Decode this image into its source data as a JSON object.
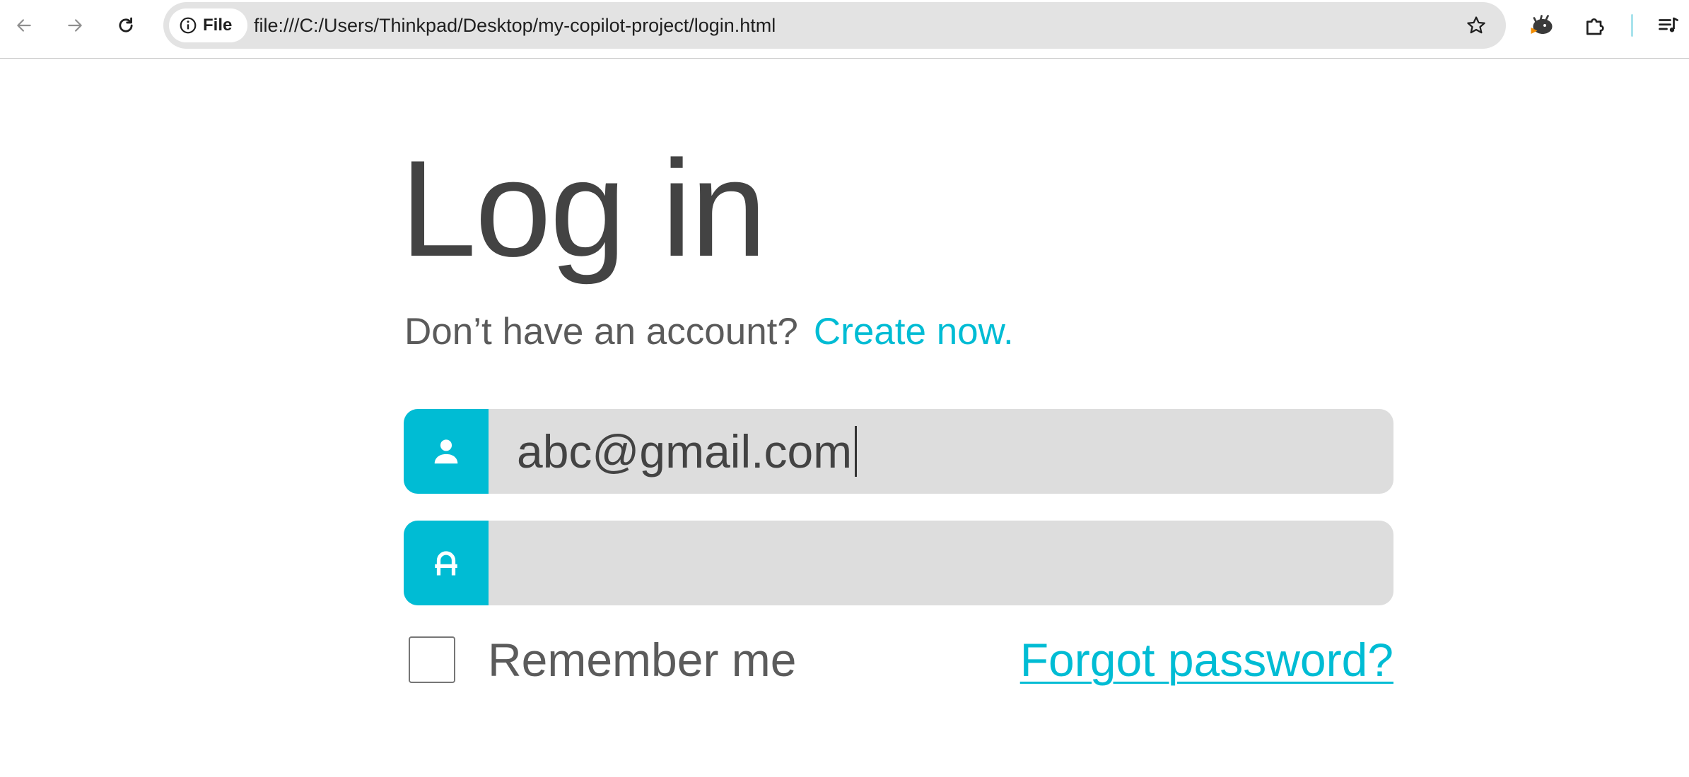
{
  "browser": {
    "site_chip_label": "File",
    "url": "file:///C:/Users/Thinkpad/Desktop/my-copilot-project/login.html"
  },
  "login": {
    "title": "Log in",
    "signup_prompt": "Don’t have an account?",
    "signup_link": "Create now.",
    "email_value": "abc@gmail.com",
    "password_value": "",
    "remember_label": "Remember me",
    "remember_checked": false,
    "forgot_link": "Forgot password?"
  },
  "colors": {
    "accent": "#00bcd4",
    "field_bg": "#dddddd",
    "title_text": "#434343",
    "muted_text": "#5b5b5b"
  },
  "icons": {
    "email_field": "user-icon",
    "password_field": "lock-icon"
  }
}
